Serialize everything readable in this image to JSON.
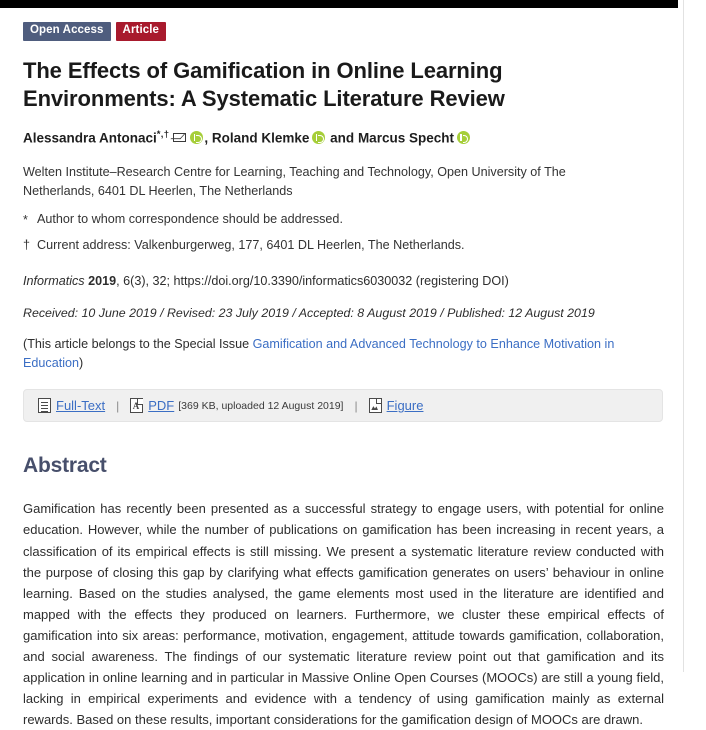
{
  "badges": {
    "open_access": "Open Access",
    "article_type": "Article",
    "open_access_color": "#4f5d7e",
    "article_type_color": "#a81a2d"
  },
  "article": {
    "title": "The Effects of Gamification in Online Learning Environments: A Systematic Literature Review",
    "authors": {
      "author1": "Alessandra Antonaci",
      "author1_marks": "*,†",
      "separator1": ",",
      "author2": "Roland Klemke",
      "conjunction": "and",
      "author3": "Marcus Specht"
    },
    "affiliation": "Welten Institute–Research Centre for Learning, Teaching and Technology, Open University of The Netherlands, 6401 DL Heerlen, The Netherlands",
    "notes": [
      {
        "mark": "*",
        "text": "Author to whom correspondence should be addressed."
      },
      {
        "mark": "†",
        "text": "Current address: Valkenburgerweg, 177, 6401 DL Heerlen, The Netherlands."
      }
    ],
    "citation": {
      "journal": "Informatics",
      "year": "2019",
      "volume_issue_page": ", 6(3), 32; ",
      "doi": "https://doi.org/10.3390/informatics6030032",
      "doi_suffix": " (registering DOI)"
    },
    "dates": "Received: 10 June 2019 / Revised: 23 July 2019 / Accepted: 8 August 2019 / Published: 12 August 2019",
    "special_issue": {
      "prefix": "(This article belongs to the Special Issue ",
      "link_text": "Gamification and Advanced Technology to Enhance Motivation in Education",
      "suffix": ")",
      "link_color": "#3b6ec4"
    }
  },
  "downloads": {
    "fulltext": {
      "label": "Full-Text",
      "icon": "document-icon"
    },
    "pdf": {
      "label": "PDF",
      "icon": "pdf-icon",
      "meta": "[369 KB, uploaded 12 August 2019]"
    },
    "figure": {
      "label": "Figure",
      "icon": "image-icon"
    },
    "separator": "|"
  },
  "abstract": {
    "heading": "Abstract",
    "heading_color": "#474f6b",
    "text": "Gamification has recently been presented as a successful strategy to engage users, with potential for online education. However, while the number of publications on gamification has been increasing in recent years, a classification of its empirical effects is still missing. We present a systematic literature review conducted with the purpose of closing this gap by clarifying what effects gamification generates on users’ behaviour in online learning. Based on the studies analysed, the game elements most used in the literature are identified and mapped with the effects they produced on learners. Furthermore, we cluster these empirical effects of gamification into six areas: performance, motivation, engagement, attitude towards gamification, collaboration, and social awareness. The findings of our systematic literature review point out that gamification and its application in online learning and in particular in Massive Online Open Courses (MOOCs) are still a young field, lacking in empirical experiments and evidence with a tendency of using gamification mainly as external rewards. Based on these results, important considerations for the gamification design of MOOCs are drawn."
  }
}
